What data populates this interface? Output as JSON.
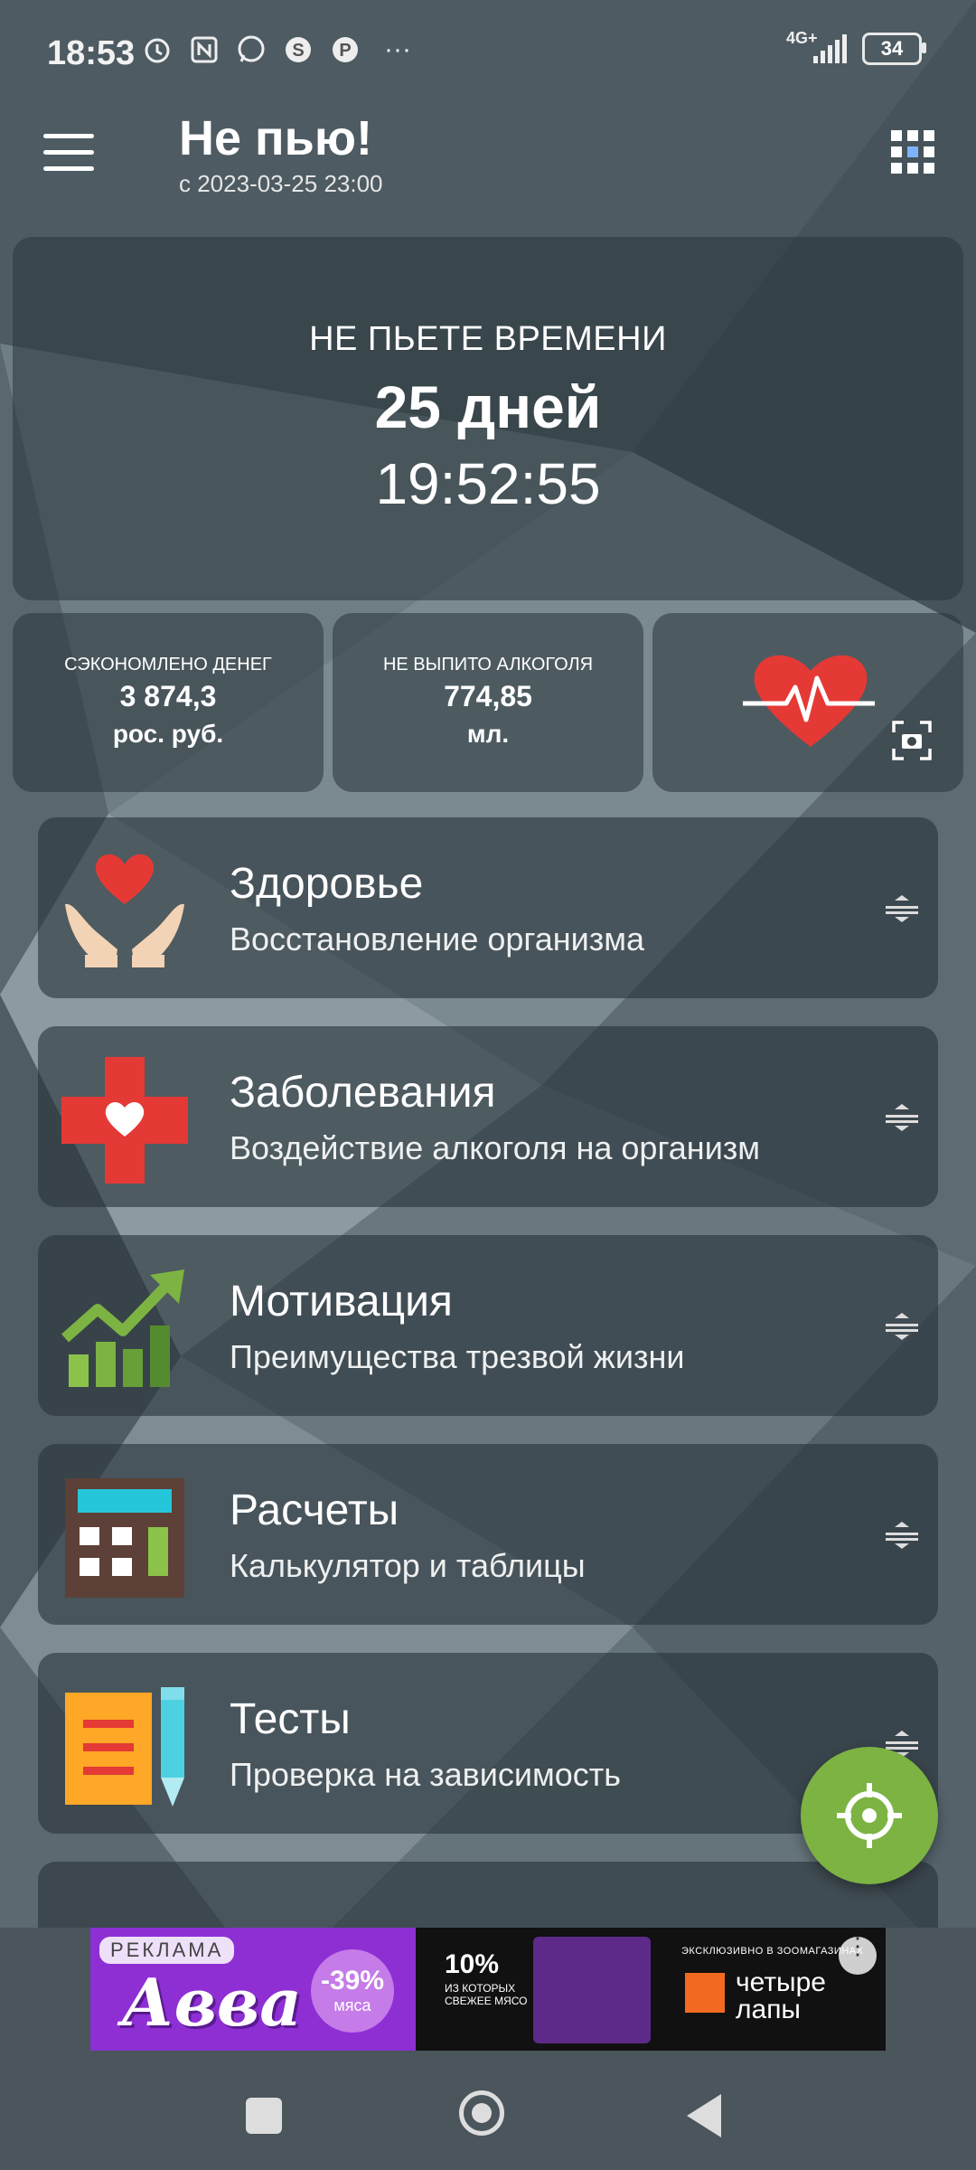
{
  "status_bar": {
    "time": "18:53",
    "network": "4G+",
    "battery": "34",
    "overflow": "···"
  },
  "header": {
    "title": "Не пью!",
    "subtitle": "с 2023-03-25 23:00"
  },
  "timer": {
    "label": "НЕ ПЬЕТЕ ВРЕМЕНИ",
    "days": "25 дней",
    "clock": "19:52:55"
  },
  "stats": [
    {
      "title": "СЭКОНОМЛЕНО ДЕНЕГ",
      "value": "3 874,3",
      "unit": "рос. руб."
    },
    {
      "title": "НЕ ВЫПИТО АЛКОГОЛЯ",
      "value": "774,85",
      "unit": "мл."
    }
  ],
  "menu": [
    {
      "title": "Здоровье",
      "subtitle": "Восстановление организма",
      "icon": "heart-hands-icon"
    },
    {
      "title": "Заболевания",
      "subtitle": "Воздействие алкоголя на организм",
      "icon": "medical-cross-icon"
    },
    {
      "title": "Мотивация",
      "subtitle": "Преимущества трезвой жизни",
      "icon": "growth-chart-icon"
    },
    {
      "title": "Расчеты",
      "subtitle": "Калькулятор и таблицы",
      "icon": "calculator-icon"
    },
    {
      "title": "Тесты",
      "subtitle": "Проверка на зависимость",
      "icon": "test-notepad-icon"
    }
  ],
  "ad": {
    "label": "РЕКЛАМА",
    "brand": "Авва",
    "discount": "-39%",
    "discount_sub": "мяса",
    "promo": "10%",
    "promo_sub": "ИЗ КОТОРЫХ СВЕЖЕЕ МЯСО",
    "exclusive": "ЭКСКЛЮЗИВНО В ЗООМАГАЗИНАХ",
    "store_line1": "четыре",
    "store_line2": "лапы"
  },
  "colors": {
    "fab": "#7cb342",
    "heart_red": "#e53935",
    "background": "#5f6b72"
  }
}
